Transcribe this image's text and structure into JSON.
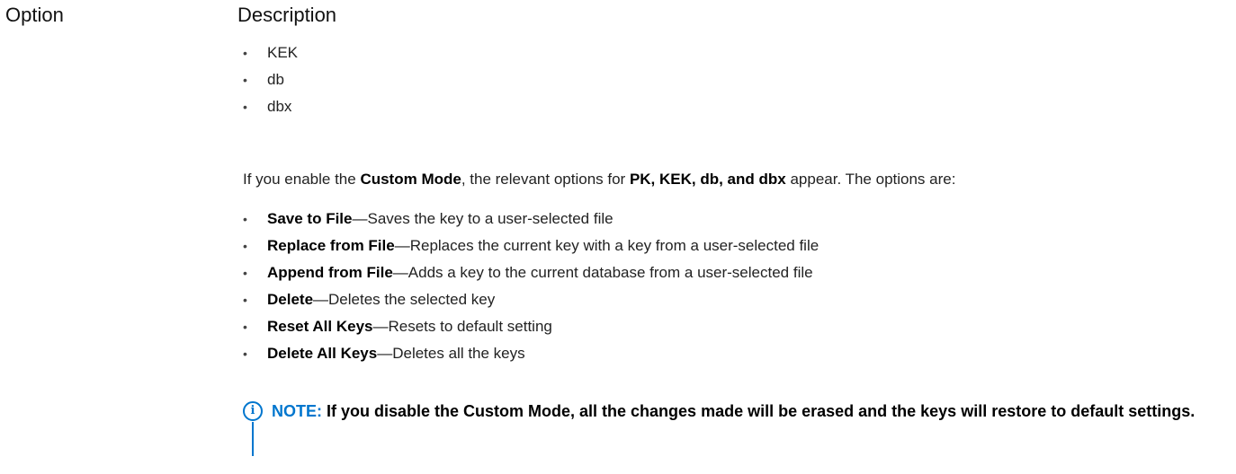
{
  "headers": {
    "option": "Option",
    "description": "Description"
  },
  "databases": [
    "KEK",
    "db",
    "dbx"
  ],
  "custom_mode_para": {
    "prefix": "If you enable the ",
    "mode_name": "Custom Mode",
    "middle": ", the relevant options for ",
    "keys": "PK, KEK, db, and dbx",
    "suffix": " appear. The options are:"
  },
  "options": [
    {
      "name": "Save to File",
      "desc": "—Saves the key to a user-selected file"
    },
    {
      "name": "Replace from File",
      "desc": "—Replaces the current key with a key from a user-selected file"
    },
    {
      "name": "Append from File",
      "desc": "—Adds a key to the current database from a user-selected file"
    },
    {
      "name": "Delete",
      "desc": "—Deletes the selected key"
    },
    {
      "name": "Reset All Keys",
      "desc": "—Resets to default setting"
    },
    {
      "name": "Delete All Keys",
      "desc": "—Deletes all the keys"
    }
  ],
  "note": {
    "icon": "info-icon",
    "label": "NOTE:",
    "text": " If you disable the Custom Mode, all the changes made will be erased and the keys will restore to default settings."
  },
  "colors": {
    "accent": "#0076ce",
    "text": "#222222"
  }
}
